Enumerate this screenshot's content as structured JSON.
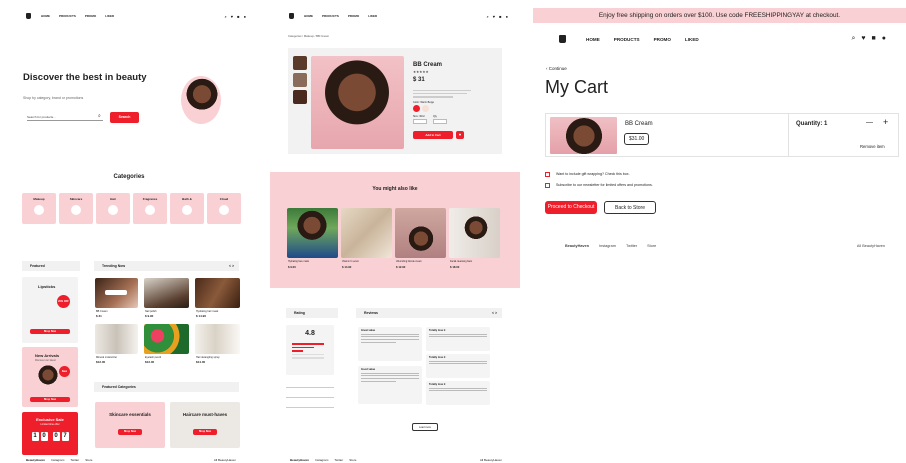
{
  "home": {
    "nav": {
      "links": [
        "HOME",
        "PRODUCTS",
        "PROMO",
        "LIKED"
      ]
    },
    "hero_title": "Discover the best in beauty",
    "hero_subtitle": "Shop by category, brand or promotions",
    "search_placeholder": "Search for products...",
    "search_button": "Search",
    "categories_title": "Categories",
    "categories": [
      "Makeup",
      "Skincare",
      "Hair",
      "Fragrance",
      "Bath &",
      "Cloud"
    ],
    "featured_label": "Featured",
    "trending_label": "Trending Now",
    "trending_pager": "< >",
    "lipsticks": {
      "title": "Lipsticks",
      "badge": "20% OFF",
      "button": "Shop Now"
    },
    "new_arrivals": {
      "title": "New Arrivals",
      "subtitle": "Discover our latest",
      "badge": "New",
      "button": "Shop Now"
    },
    "exclusive": {
      "title": "Exclusive Sale",
      "subtitle": "Limited time offer",
      "timer": [
        "1",
        "0",
        "0",
        "7"
      ]
    },
    "featured_categories_label": "Featured Categories",
    "skincare_card": {
      "title": "Skincare essentials",
      "button": "Shop Now"
    },
    "haircare_card": {
      "title": "Haircare must-haves",
      "button": "Shop Now"
    },
    "trending_items": [
      {
        "name": "BB Cream",
        "price": "$ 31"
      },
      {
        "name": "Nail polish",
        "price": "$ 9.90"
      },
      {
        "name": "Hydrating hair mask",
        "price": "$ 14.90"
      },
      {
        "name": "Mineral moisturizer",
        "price": "$12.00"
      },
      {
        "name": "Eyelash pencil",
        "price": "$12.00"
      },
      {
        "name": "Hair detangling spray",
        "price": "$14.00"
      }
    ],
    "footer": {
      "brand": "BeautyHaven",
      "links": [
        "Instagram",
        "Twitter",
        "Store"
      ],
      "right": "All BeautyHaven"
    }
  },
  "product": {
    "breadcrumb": "Categories / Makeup / BB Cream",
    "title": "BB Cream",
    "rating": "★★★★★",
    "price": "$ 31",
    "color_label": "Color: Warm Beige",
    "size_label": "Size: 30ml",
    "qty_label": "Qty",
    "add_to_cart": "Add to Cart",
    "also_like_title": "You might also like",
    "also_like": [
      {
        "name": "Hydrating face mask",
        "price": "$ 9.00"
      },
      {
        "name": "Vitamin C serum",
        "price": "$ 14.90"
      },
      {
        "name": "Volumizing blonde cream",
        "price": "$ 12.90"
      },
      {
        "name": "Facial cleansing foam",
        "price": "$ 18.00"
      }
    ],
    "rating_label": "Rating",
    "rating_score": "4.8",
    "reviews_label": "Reviews",
    "reviews_pager": "< >",
    "reviews": [
      {
        "title": "Great value"
      },
      {
        "title": "Totally love it"
      },
      {
        "title": "Good value"
      },
      {
        "title": "Totally love it"
      },
      {
        "title": "Totally love it"
      }
    ],
    "load_more": "Load more",
    "footer": {
      "brand": "BeautyHaven",
      "links": [
        "Instagram",
        "Twitter",
        "Store"
      ],
      "right": "All BeautyHaven"
    }
  },
  "cart": {
    "banner": "Enjoy free shipping on orders over $100. Use code FREESHIPPINGYAY at checkout.",
    "nav": {
      "links": [
        "HOME",
        "PRODUCTS",
        "PROMO",
        "LIKED"
      ]
    },
    "continue": "‹  Continue",
    "title": "My Cart",
    "item": {
      "name": "BB Cream",
      "price": "$31.00"
    },
    "quantity": "Quantity: 1",
    "minus": "—",
    "plus": "+",
    "remove": "Remove item",
    "gift_option": "Want to include gift wrapping? Check this box.",
    "newsletter_option": "Subscribe to our newsletter for limited offers and promotions.",
    "checkout_button": "Proceed to Checkout",
    "back_button": "Back to Store",
    "footer": {
      "brand": "BeautyHaven",
      "links": [
        "Instagram",
        "Twitter",
        "Store"
      ],
      "right": "All BeautyHaven"
    }
  },
  "colors": {
    "accent": "#ee1e2b",
    "pink": "#f9d0d3"
  }
}
